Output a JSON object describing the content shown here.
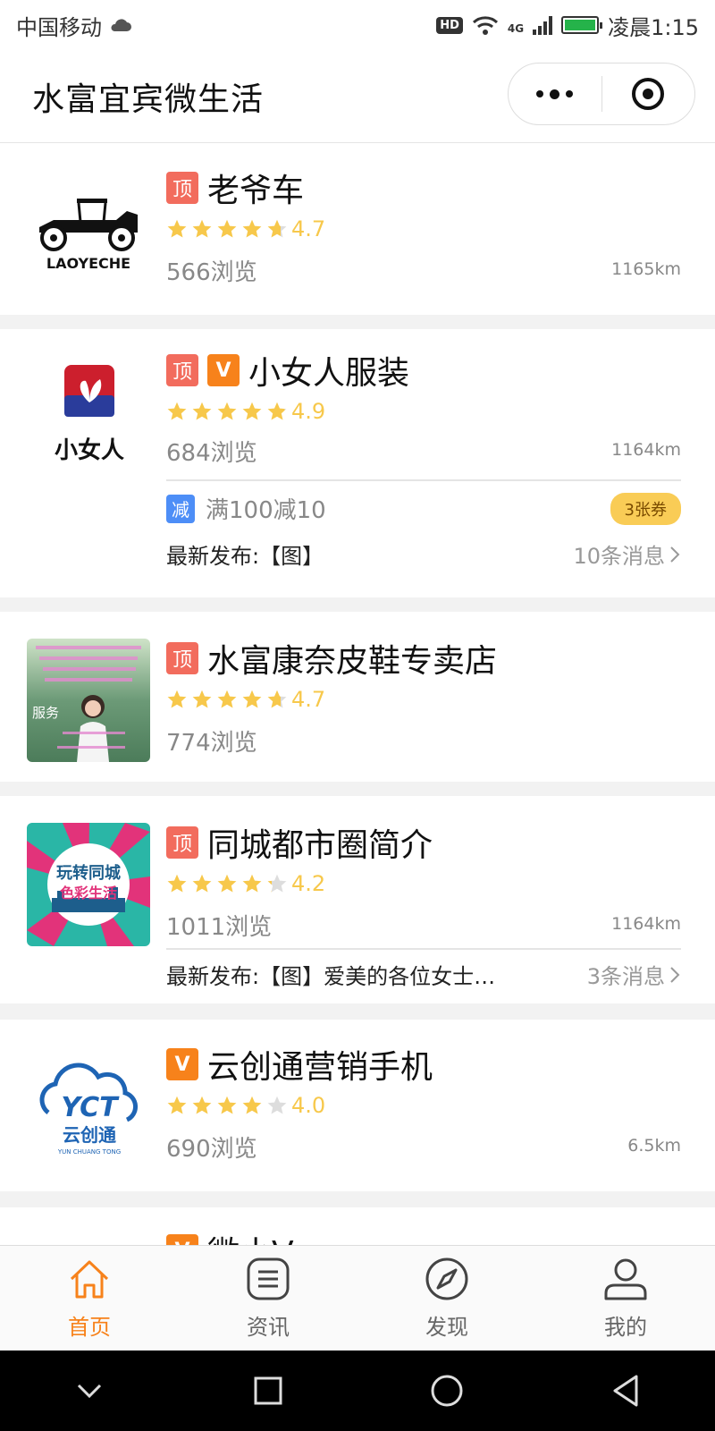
{
  "status": {
    "carrier": "中国移动",
    "hd": "HD",
    "network": "4G",
    "time": "凌晨1:15"
  },
  "nav": {
    "title": "水富宜宾微生活"
  },
  "tags": {
    "top": "顶",
    "v": "V",
    "discount": "减"
  },
  "shops": [
    {
      "name": "老爷车",
      "rating": "4.7",
      "rating_value": 4.7,
      "views": "566浏览",
      "distance": "1165km",
      "logo_text": "LAOYECHE"
    },
    {
      "name": "小女人服装",
      "rating": "4.9",
      "rating_value": 4.9,
      "views": "684浏览",
      "distance": "1164km",
      "logo_text": "小女人",
      "promo": "满100减10",
      "coupon": "3张券",
      "latest": "最新发布:【图】",
      "messages": "10条消息"
    },
    {
      "name": "水富康奈皮鞋专卖店",
      "rating": "4.7",
      "rating_value": 4.7,
      "views": "774浏览",
      "logo_text": "服务"
    },
    {
      "name": "同城都市圈简介",
      "rating": "4.2",
      "rating_value": 4.2,
      "views": "1011浏览",
      "distance": "1164km",
      "logo_text_1": "玩转同城",
      "logo_text_2": "色彩生活",
      "latest": "最新发布:【图】爱美的各位女士…",
      "messages": "3条消息"
    },
    {
      "name": "云创通营销手机",
      "rating": "4.0",
      "rating_value": 4.0,
      "views": "690浏览",
      "distance": "6.5km",
      "logo_text_1": "YCT",
      "logo_text_2": "云创通",
      "logo_text_3": "YUN CHUANG TONG"
    },
    {
      "name": "微小V"
    }
  ],
  "tabbar": [
    {
      "label": "首页",
      "icon": "home-icon",
      "active": true
    },
    {
      "label": "资讯",
      "icon": "news-icon"
    },
    {
      "label": "发现",
      "icon": "compass-icon"
    },
    {
      "label": "我的",
      "icon": "user-icon"
    }
  ],
  "colors": {
    "accent": "#f7821b",
    "star": "#f7c84b",
    "top_tag": "#f26c5d",
    "discount_tag": "#4d8ef7",
    "coupon": "#f9cc56"
  }
}
